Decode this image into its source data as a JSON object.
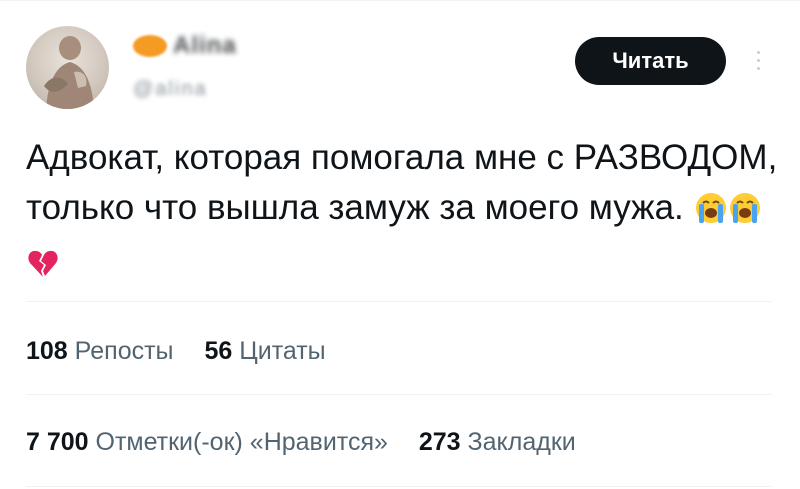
{
  "user": {
    "display_name": "Alina",
    "handle": "@alina",
    "badge_color": "#f59b23"
  },
  "follow_button_label": "Читать",
  "more_icon": "more-vertical-icon",
  "tweet": {
    "text": "Адвокат, которая помогала мне с РАЗВОДОМ, только что вышла замуж за моего мужа.",
    "emojis": [
      "loudly-crying-face",
      "loudly-crying-face",
      "broken-heart"
    ]
  },
  "stats": {
    "reposts_count": "108",
    "reposts_label": "Репосты",
    "quotes_count": "56",
    "quotes_label": "Цитаты",
    "likes_count": "7 700",
    "likes_label": "Отметки(-ок) «Нравится»",
    "bookmarks_count": "273",
    "bookmarks_label": "Закладки"
  },
  "colors": {
    "text": "#0f1419",
    "secondary": "#536471",
    "divider": "#eff3f4",
    "button": "#0f1419"
  }
}
